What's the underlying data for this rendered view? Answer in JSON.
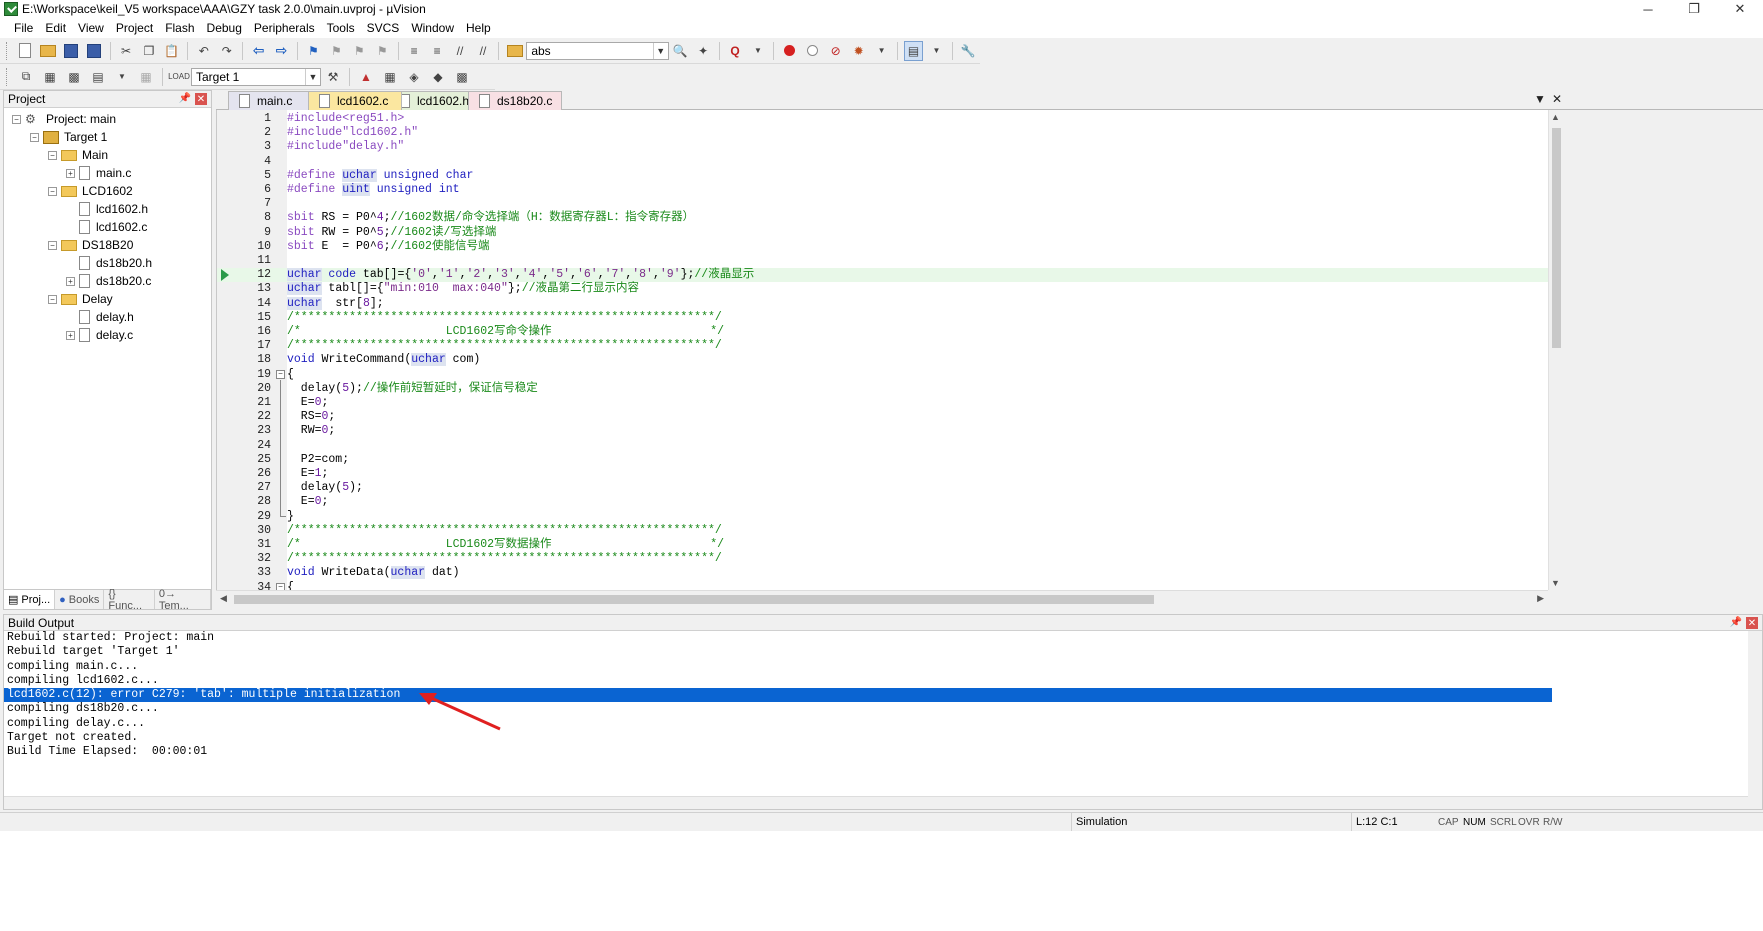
{
  "window": {
    "title": "E:\\Workspace\\keil_V5 workspace\\AAA\\GZY task 2.0.0\\main.uvproj - µVision",
    "minimize": "─",
    "restore": "❐",
    "close": "✕"
  },
  "menu": [
    "File",
    "Edit",
    "View",
    "Project",
    "Flash",
    "Debug",
    "Peripherals",
    "Tools",
    "SVCS",
    "Window",
    "Help"
  ],
  "toolbar": {
    "find_value": "abs",
    "target_value": "Target 1"
  },
  "project_panel": {
    "title": "Project",
    "tree": [
      {
        "label": "Project: main",
        "depth": 0,
        "type": "project",
        "expander": "−"
      },
      {
        "label": "Target 1",
        "depth": 1,
        "type": "target",
        "expander": "−"
      },
      {
        "label": "Main",
        "depth": 2,
        "type": "folder",
        "expander": "−"
      },
      {
        "label": "main.c",
        "depth": 3,
        "type": "file",
        "expander": "+"
      },
      {
        "label": "LCD1602",
        "depth": 2,
        "type": "folder",
        "expander": "−"
      },
      {
        "label": "lcd1602.h",
        "depth": 3,
        "type": "file",
        "expander": ""
      },
      {
        "label": "lcd1602.c",
        "depth": 3,
        "type": "file",
        "expander": ""
      },
      {
        "label": "DS18B20",
        "depth": 2,
        "type": "folder",
        "expander": "−"
      },
      {
        "label": "ds18b20.h",
        "depth": 3,
        "type": "file",
        "expander": ""
      },
      {
        "label": "ds18b20.c",
        "depth": 3,
        "type": "file",
        "expander": "+"
      },
      {
        "label": "Delay",
        "depth": 2,
        "type": "folder",
        "expander": "−"
      },
      {
        "label": "delay.h",
        "depth": 3,
        "type": "file",
        "expander": ""
      },
      {
        "label": "delay.c",
        "depth": 3,
        "type": "file",
        "expander": "+"
      }
    ],
    "tabs": [
      "Proj...",
      "Books",
      "{} Func...",
      "0→ Tem..."
    ]
  },
  "editor": {
    "tabs": [
      "main.c",
      "lcd1602.c",
      "lcd1602.h",
      "ds18b20.c"
    ],
    "active_tab": "lcd1602.c",
    "current_line": 12,
    "lines": [
      {
        "n": "1",
        "t": "#include<reg51.h>"
      },
      {
        "n": "2",
        "t": "#include\"lcd1602.h\""
      },
      {
        "n": "3",
        "t": "#include\"delay.h\""
      },
      {
        "n": "4",
        "t": ""
      },
      {
        "n": "5",
        "t": "#define uchar unsigned char"
      },
      {
        "n": "6",
        "t": "#define uint unsigned int"
      },
      {
        "n": "7",
        "t": ""
      },
      {
        "n": "8",
        "t": "sbit RS = P0^4;//1602数据/命令选择端（H：数据寄存器L：指令寄存器）"
      },
      {
        "n": "9",
        "t": "sbit RW = P0^5;//1602读/写选择端"
      },
      {
        "n": "10",
        "t": "sbit E  = P0^6;//1602使能信号端"
      },
      {
        "n": "11",
        "t": ""
      },
      {
        "n": "12",
        "t": "uchar code tab[]={'0','1','2','3','4','5','6','7','8','9'};//液晶显示"
      },
      {
        "n": "13",
        "t": "uchar tabl[]={\"min:010  max:040\"};//液晶第二行显示内容"
      },
      {
        "n": "14",
        "t": "uchar  str[8];"
      },
      {
        "n": "15",
        "t": "/*************************************************************/"
      },
      {
        "n": "16",
        "t": "/*                     LCD1602写命令操作                       */"
      },
      {
        "n": "17",
        "t": "/*************************************************************/"
      },
      {
        "n": "18",
        "t": "void WriteCommand(uchar com)"
      },
      {
        "n": "19",
        "t": "{"
      },
      {
        "n": "20",
        "t": "  delay(5);//操作前短暂延时，保证信号稳定"
      },
      {
        "n": "21",
        "t": "  E=0;"
      },
      {
        "n": "22",
        "t": "  RS=0;"
      },
      {
        "n": "23",
        "t": "  RW=0;"
      },
      {
        "n": "24",
        "t": ""
      },
      {
        "n": "25",
        "t": "  P2=com;"
      },
      {
        "n": "26",
        "t": "  E=1;"
      },
      {
        "n": "27",
        "t": "  delay(5);"
      },
      {
        "n": "28",
        "t": "  E=0;"
      },
      {
        "n": "29",
        "t": "}"
      },
      {
        "n": "30",
        "t": "/*************************************************************/"
      },
      {
        "n": "31",
        "t": "/*                     LCD1602写数据操作                       */"
      },
      {
        "n": "32",
        "t": "/*************************************************************/"
      },
      {
        "n": "33",
        "t": "void WriteData(uchar dat)"
      },
      {
        "n": "34",
        "t": "{"
      }
    ]
  },
  "build_output": {
    "title": "Build Output",
    "selected_index": 4,
    "lines": [
      "Rebuild started: Project: main",
      "Rebuild target 'Target 1'",
      "compiling main.c...",
      "compiling lcd1602.c...",
      "lcd1602.c(12): error C279: 'tab': multiple initialization",
      "compiling ds18b20.c...",
      "compiling delay.c...",
      "Target not created.",
      "Build Time Elapsed:  00:00:01"
    ]
  },
  "status": {
    "mode": "Simulation",
    "position": "L:12 C:1",
    "flags": [
      "CAP",
      "NUM",
      "SCRL",
      "OVR",
      "R/W"
    ],
    "active_flag": "NUM"
  },
  "colors": {
    "selection": "#0a64d2",
    "annotation": "#e02020",
    "current_line": "#e8f8e8"
  }
}
